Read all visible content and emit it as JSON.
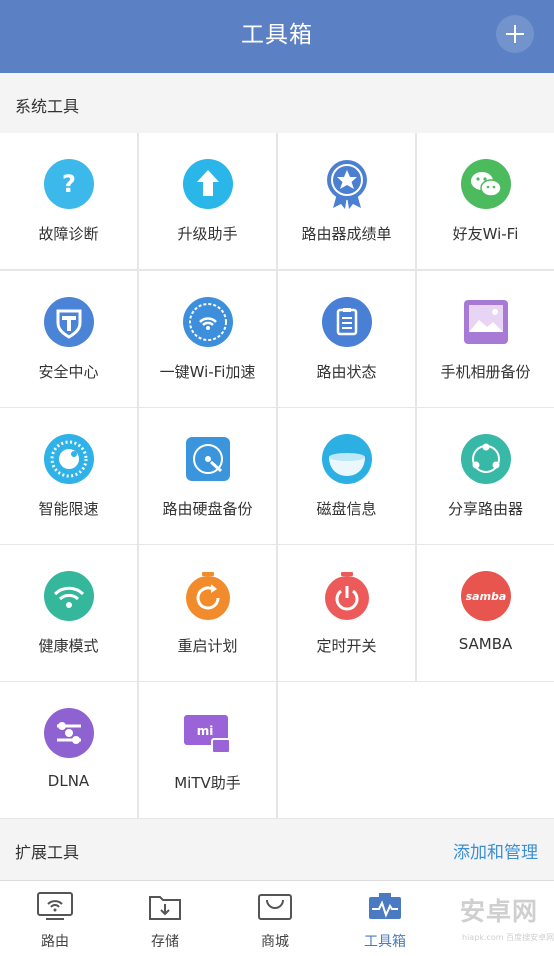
{
  "header": {
    "title": "工具箱"
  },
  "sections": {
    "system": {
      "label": "系统工具"
    },
    "extension": {
      "label": "扩展工具",
      "action": "添加和管理"
    }
  },
  "tools": [
    {
      "label": "故障诊断",
      "icon": "question-icon",
      "color": "#3db8ea"
    },
    {
      "label": "升级助手",
      "icon": "upgrade-arrow-icon",
      "color": "#2ab6e8"
    },
    {
      "label": "路由器成绩单",
      "icon": "award-ribbon-icon",
      "color": "#4a7fd1"
    },
    {
      "label": "好友Wi-Fi",
      "icon": "wechat-icon",
      "color": "#4cbb5e"
    },
    {
      "label": "安全中心",
      "icon": "shield-icon",
      "color": "#4b84d6"
    },
    {
      "label": "一键Wi-Fi加速",
      "icon": "wifi-boost-icon",
      "color": "#3d8fdc"
    },
    {
      "label": "路由状态",
      "icon": "clipboard-icon",
      "color": "#4a7fd6"
    },
    {
      "label": "手机相册备份",
      "icon": "photo-icon",
      "color": "#a77ad6"
    },
    {
      "label": "智能限速",
      "icon": "speed-dial-icon",
      "color": "#2eb2e8"
    },
    {
      "label": "路由硬盘备份",
      "icon": "hard-disk-icon",
      "color": "#3a95dc"
    },
    {
      "label": "磁盘信息",
      "icon": "disk-bowl-icon",
      "color": "#2cb0e4"
    },
    {
      "label": "分享路由器",
      "icon": "share-icon",
      "color": "#38b8a6"
    },
    {
      "label": "健康模式",
      "icon": "wifi-health-icon",
      "color": "#35b79b"
    },
    {
      "label": "重启计划",
      "icon": "restart-timer-icon",
      "color": "#f18b2c"
    },
    {
      "label": "定时开关",
      "icon": "power-timer-icon",
      "color": "#ec5a5a"
    },
    {
      "label": "SAMBA",
      "icon": "samba-icon",
      "color": "#e8544e"
    },
    {
      "label": "DLNA",
      "icon": "dlna-icon",
      "color": "#8f62d1"
    },
    {
      "label": "MiTV助手",
      "icon": "mitv-icon",
      "color": "#9a64d8"
    }
  ],
  "tabs": [
    {
      "label": "路由",
      "icon": "router-tab-icon"
    },
    {
      "label": "存储",
      "icon": "storage-tab-icon"
    },
    {
      "label": "商城",
      "icon": "store-tab-icon"
    },
    {
      "label": "工具箱",
      "icon": "toolbox-tab-icon",
      "active": true
    }
  ],
  "watermark": {
    "text": "安卓网",
    "sub": "hiapk.com 百度搜安卓网"
  },
  "colors": {
    "header": "#5b80c3",
    "accent": "#3d8fd1",
    "active_tab": "#4a7ac1"
  }
}
